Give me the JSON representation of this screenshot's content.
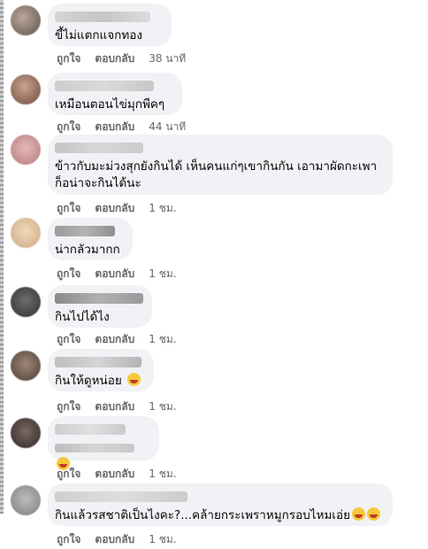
{
  "actions": {
    "like": "ถูกใจ",
    "reply": "ตอบกลับ"
  },
  "comments": [
    {
      "text": "ขี้ไม่แตกแจกทอง",
      "time": "38 นาที"
    },
    {
      "text": "เหมือนตอนไข่มุกพีคๆ",
      "time": "44 นาที"
    },
    {
      "text": "ข้าวกับมะม่วงสุกยังกินได้ เห็นคนแก่ๆเขากินกัน เอามาผัดกะเพา\nก็อน่าจะกินได้นะ",
      "time": "1 ชม."
    },
    {
      "text": "น่ากลัวมากก",
      "time": "1 ชม."
    },
    {
      "text": "กินไปได้ไง",
      "time": "1 ชม."
    },
    {
      "text": "กินให้ดูหน่อย",
      "time": "1 ชม."
    },
    {
      "text": "",
      "time": "1 ชม."
    },
    {
      "text": "กินแล้วรสชาติเป็นไงคะ?...คล้ายกระเพราหมูกรอบไหมเอ่ย",
      "time": "1 ชม."
    }
  ]
}
